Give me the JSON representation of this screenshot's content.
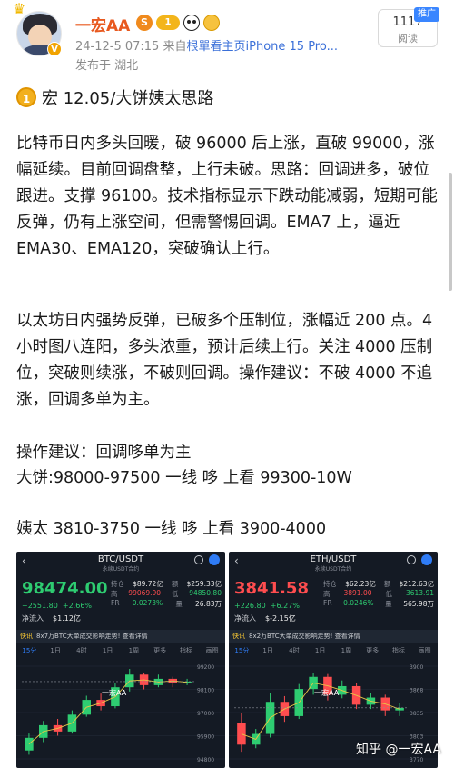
{
  "author": {
    "name": "一宏AA",
    "level_badge": "S",
    "level_number": "1",
    "vip_mark": "V",
    "crown_icon": "crown-icon"
  },
  "post_meta": {
    "datetime": "24-12-5 07:15",
    "source_prefix": "来自",
    "source_link": "根單看主页iPhone 15 Pro...",
    "location": "发布于 湖北"
  },
  "read_count": {
    "value": "1117",
    "label": "阅读"
  },
  "promo_tag": "推广",
  "article": {
    "title_icon": "1",
    "title": "宏 12.05/大饼姨太思路",
    "paragraph1": "比特币日内多头回暖，破 96000 后上涨，直破 99000，涨幅延续。目前回调盘整，上行未破。思路：回调进多，破位跟进。支撑 96100。技术指标显示下跌动能减弱，短期可能反弹，仍有上涨空间，但需警惕回调。EMA7 上，逼近 EMA30、EMA120，突破确认上行。",
    "paragraph2": "以太坊日内强势反弹，已破多个压制位，涨幅近 200 点。4 小时图八连阳，多头浓重，预计后续上行。关注 4000 压制位，突破则续涨，不破则回调。操作建议：不破 4000 不追涨，回调多单为主。",
    "advice_line": "操作建议：回调哆单为主",
    "btc_line": "大饼:98000-97500 一线  哆  上看 99300-10W",
    "eth_line": "姨太 3810-3750 一线  哆  上看 3900-4000"
  },
  "charts": [
    {
      "pair": "BTC/USDT",
      "sub": "永续USDT合约",
      "price": "98474.00",
      "price_color": "#2ecc71",
      "change_abs": "+2551.80",
      "change_pct": "+2.66%",
      "net_label": "净流入",
      "net_value": "$1.12亿",
      "stats": [
        {
          "k": "持仓",
          "v": "$89.72亿",
          "k2": "额",
          "v2": "$259.33亿"
        },
        {
          "k": "高",
          "v": "99069.90",
          "k2": "低",
          "v2": "94850.80"
        },
        {
          "k": "FR",
          "v": "0.0273%",
          "k2": "量",
          "v2": "26.83万"
        }
      ],
      "banner_tag": "快讯",
      "banner_text": "8x7万BTC大单成交影响走势! 查看详情",
      "tabs": [
        "15分",
        "1日",
        "4时",
        "1日",
        "1周",
        "更多",
        "指标",
        "画图"
      ],
      "active_tab": 0,
      "watermark": "一宏AA"
    },
    {
      "pair": "ETH/USDT",
      "sub": "永续USDT合约",
      "price": "3841.58",
      "price_color": "#ff4d4f",
      "change_abs": "+226.80",
      "change_pct": "+6.27%",
      "net_label": "净流入",
      "net_value": "$-2.15亿",
      "stats": [
        {
          "k": "持仓",
          "v": "$62.23亿",
          "k2": "额",
          "v2": "$212.63亿"
        },
        {
          "k": "高",
          "v": "3891.00",
          "k2": "低",
          "v2": "3613.91"
        },
        {
          "k": "FR",
          "v": "0.0246%",
          "k2": "量",
          "v2": "565.98万"
        }
      ],
      "banner_tag": "快讯",
      "banner_text": "8x2万BTC大单成交影响走势! 查看详情",
      "tabs": [
        "15分",
        "1日",
        "4时",
        "1日",
        "1周",
        "更多",
        "指标",
        "画图"
      ],
      "active_tab": 0,
      "watermark": "一宏AA"
    }
  ],
  "site_watermark": "知乎 @一宏AA",
  "colors": {
    "username": "#e8591f",
    "source_link": "#3a6fd8",
    "promo": "#3a86ff",
    "chart_bg": "#141a24",
    "up": "#2ecc71",
    "down": "#ff4d4f"
  },
  "chart_data": [
    {
      "type": "candlestick",
      "title": "BTC/USDT",
      "candles": [
        {
          "o": 95.2,
          "c": 95.8,
          "h": 96.0,
          "l": 95.0
        },
        {
          "o": 95.8,
          "c": 96.4,
          "h": 96.6,
          "l": 95.6
        },
        {
          "o": 96.4,
          "c": 96.1,
          "h": 96.7,
          "l": 95.9
        },
        {
          "o": 96.1,
          "c": 96.9,
          "h": 97.1,
          "l": 96.0
        },
        {
          "o": 96.9,
          "c": 97.6,
          "h": 97.8,
          "l": 96.8
        },
        {
          "o": 97.6,
          "c": 97.3,
          "h": 97.9,
          "l": 97.1
        },
        {
          "o": 97.3,
          "c": 98.2,
          "h": 98.4,
          "l": 97.2
        },
        {
          "o": 98.2,
          "c": 98.8,
          "h": 99.07,
          "l": 98.0
        },
        {
          "o": 98.8,
          "c": 98.3,
          "h": 98.9,
          "l": 98.1
        },
        {
          "o": 98.3,
          "c": 98.6,
          "h": 98.8,
          "l": 98.2
        },
        {
          "o": 98.6,
          "c": 98.4,
          "h": 98.7,
          "l": 98.2
        },
        {
          "o": 98.4,
          "c": 98.47,
          "h": 98.6,
          "l": 98.3
        }
      ],
      "ylim": [
        94.8,
        99.2
      ]
    },
    {
      "type": "candlestick",
      "title": "ETH/USDT",
      "candles": [
        {
          "o": 3820,
          "c": 3790,
          "h": 3835,
          "l": 3780
        },
        {
          "o": 3790,
          "c": 3805,
          "h": 3812,
          "l": 3785
        },
        {
          "o": 3805,
          "c": 3850,
          "h": 3862,
          "l": 3800
        },
        {
          "o": 3850,
          "c": 3830,
          "h": 3858,
          "l": 3822
        },
        {
          "o": 3830,
          "c": 3868,
          "h": 3875,
          "l": 3826
        },
        {
          "o": 3868,
          "c": 3885,
          "h": 3891,
          "l": 3860
        },
        {
          "o": 3885,
          "c": 3860,
          "h": 3889,
          "l": 3852
        },
        {
          "o": 3860,
          "c": 3872,
          "h": 3880,
          "l": 3855
        },
        {
          "o": 3872,
          "c": 3846,
          "h": 3876,
          "l": 3840
        },
        {
          "o": 3846,
          "c": 3856,
          "h": 3862,
          "l": 3840
        },
        {
          "o": 3856,
          "c": 3838,
          "h": 3860,
          "l": 3830
        },
        {
          "o": 3838,
          "c": 3841.58,
          "h": 3848,
          "l": 3830
        }
      ],
      "ylim": [
        3770,
        3900
      ]
    }
  ]
}
